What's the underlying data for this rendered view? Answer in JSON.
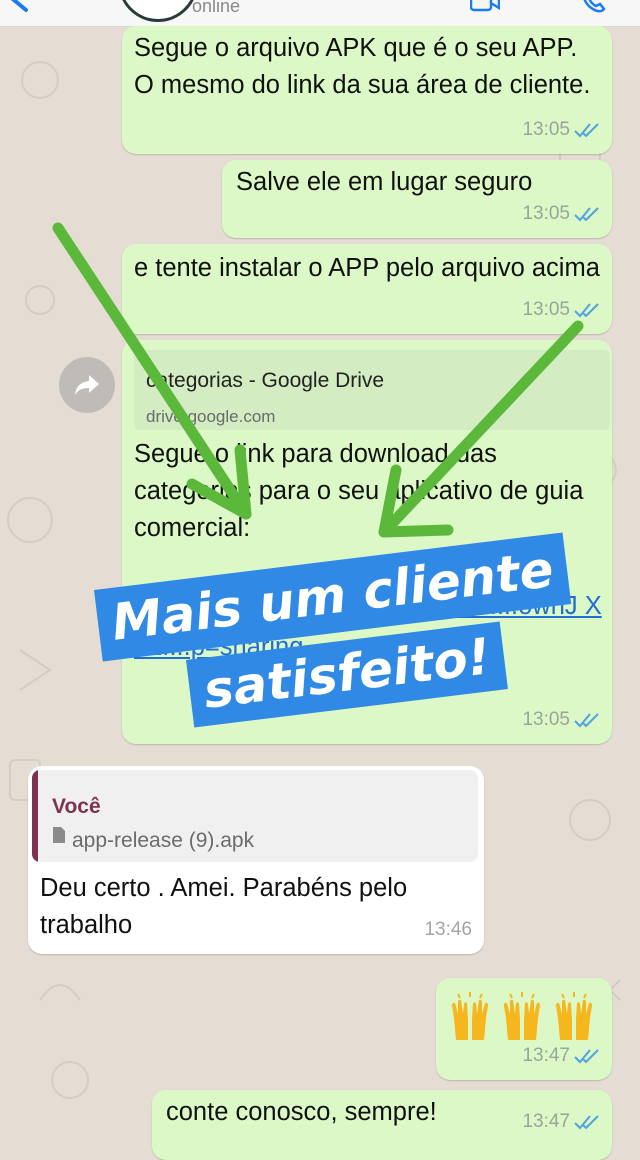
{
  "header": {
    "status": "online"
  },
  "messages": [
    {
      "id": "m1",
      "text": "Segue o arquivo APK que é o seu APP. O mesmo do link da sua área de cliente.",
      "time": "13:05"
    },
    {
      "id": "m2",
      "text": "Salve ele em lugar seguro",
      "time": "13:05"
    },
    {
      "id": "m3",
      "text": "e tente instalar o APP pelo arquivo acima",
      "time": "13:05"
    },
    {
      "id": "m4",
      "link_preview": {
        "title": "categorias - Google Drive",
        "domain": "drive.google.com"
      },
      "text": "Segue o link para download das categorias para o seu aplicativo de guia comercial:",
      "link": "https://drive.google.com/...17cTI...ownJ Xd1f...p=sharing",
      "time": "13:05"
    },
    {
      "id": "m5",
      "quoted": {
        "author": "Você",
        "file": "app-release (9).apk"
      },
      "text": "Deu certo . Amei. Parabéns pelo trabalho",
      "time": "13:46"
    },
    {
      "id": "m6",
      "emoji": "🙌🙌🙌",
      "time": "13:47"
    },
    {
      "id": "m7",
      "text": "conte conosco, sempre!",
      "time": "13:47"
    }
  ],
  "overlay": {
    "banner_line1": "Mais um cliente",
    "banner_line2": "satisfeito!",
    "banner_color": "#2f89e5",
    "arrow_color": "#5cb83a"
  },
  "colors": {
    "outgoing_bubble": "#dcf8c6",
    "incoming_bubble": "#ffffff",
    "read_ticks": "#4fa3e0",
    "quote_accent": "#7d3350"
  }
}
